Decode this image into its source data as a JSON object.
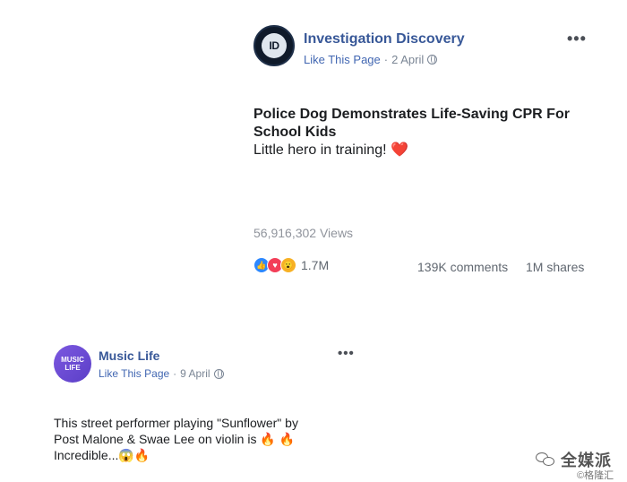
{
  "post1": {
    "avatar_text": "ID",
    "page_name": "Investigation Discovery",
    "like_page": "Like This Page",
    "separator": "·",
    "date": "2 April",
    "more": "•••",
    "headline": "Police Dog Demonstrates Life-Saving CPR For School Kids",
    "body": "Little hero in training! ❤️",
    "views": "56,916,302 Views",
    "reaction_count": "1.7M",
    "comments": "139K comments",
    "shares": "1M shares"
  },
  "post2": {
    "avatar_line1": "MUSIC",
    "avatar_line2": "LIFE",
    "page_name": "Music Life",
    "like_page": "Like This Page",
    "separator": "·",
    "date": "9 April",
    "more": "•••",
    "body_line1": "This street performer playing \"Sunflower\" by",
    "body_line2": "Post Malone & Swae Lee on violin is 🔥 🔥",
    "body_line3": "Incredible...😱🔥"
  },
  "watermark": {
    "main": "全媒派",
    "sub": "©格隆汇"
  }
}
